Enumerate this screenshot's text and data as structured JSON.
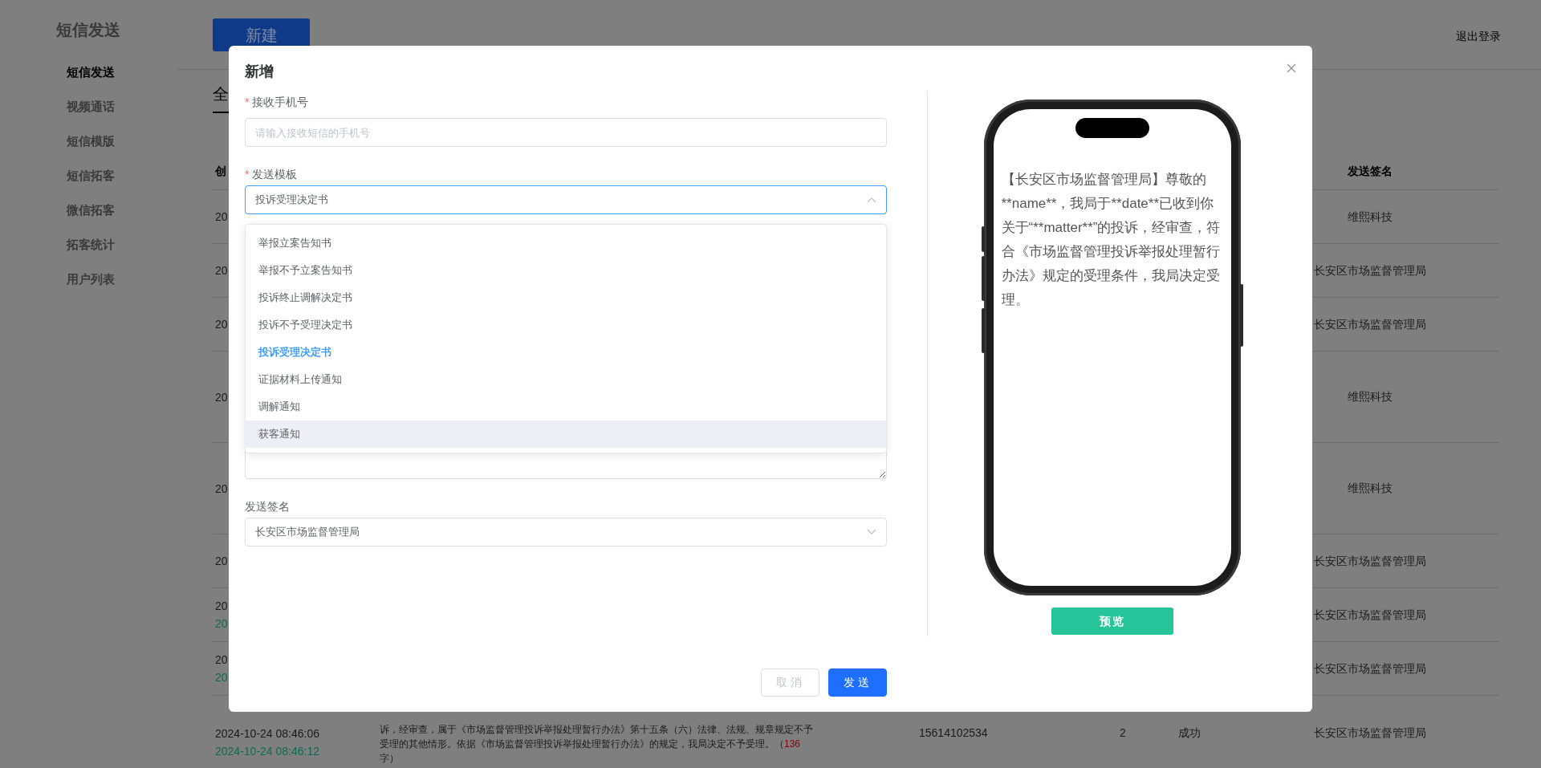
{
  "sidebar": {
    "title": "短信发送",
    "items": [
      {
        "label": "短信发送",
        "selected": true
      },
      {
        "label": "视频通话",
        "selected": false
      },
      {
        "label": "短信模版",
        "selected": false
      },
      {
        "label": "短信拓客",
        "selected": false
      },
      {
        "label": "微信拓客",
        "selected": false
      },
      {
        "label": "拓客统计",
        "selected": false
      },
      {
        "label": "用户列表",
        "selected": false
      }
    ]
  },
  "toolbar": {
    "new_button": "新建",
    "logout": "退出登录"
  },
  "tabs": [
    {
      "label": "全",
      "selected": true
    }
  ],
  "table": {
    "header": {
      "column_1": "创",
      "column_6": "发送签名"
    },
    "rows": [
      {
        "column_1": [
          "20"
        ],
        "column_6": "维熙科技"
      },
      {
        "column_1": [
          "20"
        ],
        "column_6": "长安区市场监督管理局"
      },
      {
        "column_1": [
          "20"
        ],
        "column_6": "长安区市场监督管理局"
      },
      {
        "column_1": [
          "20"
        ],
        "column_6": "维熙科技"
      },
      {
        "column_1": [
          "20"
        ],
        "column_6": "维熙科技"
      },
      {
        "column_1": [
          "20"
        ],
        "column_6": "长安区市场监督管理局"
      },
      {
        "column_1": [
          "20",
          "20"
        ],
        "column_6": "长安区市场监督管理局"
      },
      {
        "column_1": [
          "20",
          "20"
        ],
        "column_6": "长安区市场监督管理局"
      },
      {
        "column_1": [
          "2024-10-24 08:46:06",
          "2024-10-24 08:46:12"
        ],
        "column_2": {
          "text": "诉，经审查，属于《市场监督管理投诉举报处理暂行办法》第十五条（六）法律、法规、规章规定不予受理的其他情形。依据《市场监督管理投诉举报处理暂行办法》的规定，我局决定不予受理。（",
          "count": "136",
          "suffix": "字）"
        },
        "column_3": "15614102534",
        "column_4": "2",
        "column_5": "成功",
        "column_6": "长安区市场监督管理局"
      }
    ]
  },
  "dialog": {
    "title": "新增",
    "fields": [
      {
        "kind": "input",
        "label": "接收手机号",
        "required_mark": "*",
        "placeholder": "请输入接收短信的手机号"
      },
      {
        "kind": "select",
        "label": "发送模板",
        "required_mark": "*",
        "value": "投诉受理决定书",
        "expanded": true,
        "options": [
          {
            "label": "举报立案告知书",
            "selected": false,
            "hovered": false
          },
          {
            "label": "举报不予立案告知书",
            "selected": false,
            "hovered": false
          },
          {
            "label": "投诉终止调解决定书",
            "selected": false,
            "hovered": false
          },
          {
            "label": "投诉不予受理决定书",
            "selected": false,
            "hovered": false
          },
          {
            "label": "投诉受理决定书",
            "selected": true,
            "hovered": false
          },
          {
            "label": "证据材料上传通知",
            "selected": false,
            "hovered": false
          },
          {
            "label": "调解通知",
            "selected": false,
            "hovered": false
          },
          {
            "label": "获客通知",
            "selected": false,
            "hovered": true
          }
        ]
      },
      {
        "kind": "textarea"
      },
      {
        "kind": "select",
        "label": "发送签名",
        "value": "长安区市场监督管理局",
        "expanded": false
      }
    ],
    "buttons": [
      {
        "label": "取消",
        "kind": "default"
      },
      {
        "label": "发送",
        "kind": "primary"
      }
    ],
    "preview": {
      "message": "【长安区市场监督管理局】尊敬的**name**，我局于**date**已收到你关于“**matter**”的投诉，经审查，符合《市场监督管理投诉举报处理暂行办法》规定的受理条件，我局决定受理。",
      "button": "预览"
    }
  }
}
